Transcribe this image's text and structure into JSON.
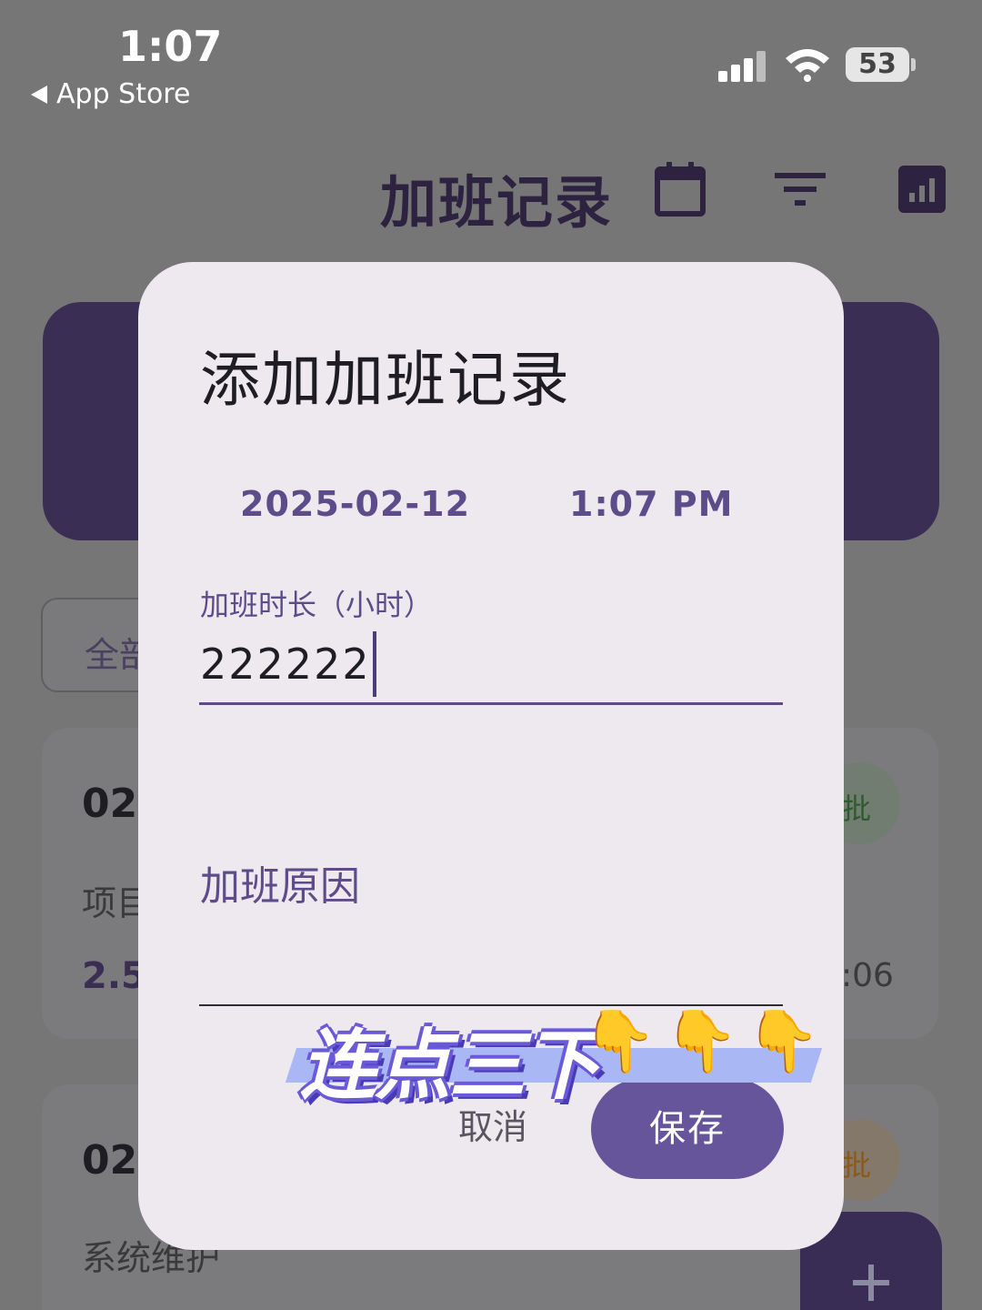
{
  "status_bar": {
    "time": "1:07",
    "back_label": "App Store",
    "battery": "53"
  },
  "app_bar": {
    "title": "加班记录",
    "icons": [
      "calendar-icon",
      "filter-icon",
      "chart-icon"
    ]
  },
  "background": {
    "filter_chip": "全部",
    "records": [
      {
        "date": "02",
        "subtitle": "项目",
        "hours": "2.5",
        "badge": "批",
        "time": ":06"
      },
      {
        "date": "02",
        "subtitle": "系统维护",
        "badge": "批"
      }
    ]
  },
  "dialog": {
    "title": "添加加班记录",
    "date": "2025-02-12",
    "time": "1:07 PM",
    "duration_label": "加班时长（小时）",
    "duration_value": "222222",
    "reason_label": "加班原因",
    "cancel_label": "取消",
    "save_label": "保存"
  },
  "overlay": {
    "caption": "连点三下",
    "hand_emoji": "👇"
  },
  "colors": {
    "primary": "#66559a",
    "primary_dark": "#3b2e55",
    "dialog_bg": "#ede9ef",
    "scrim": "#767676"
  }
}
